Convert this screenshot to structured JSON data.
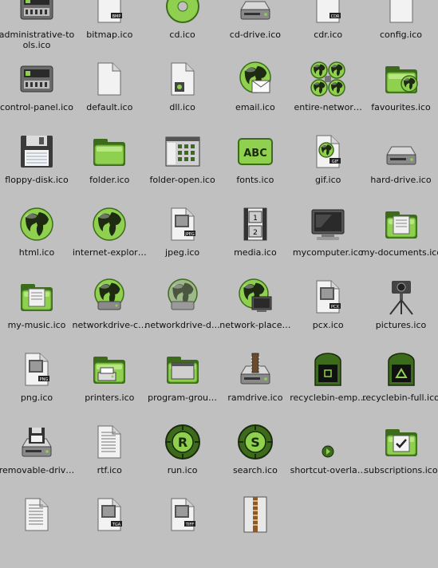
{
  "icons": [
    {
      "label": "administrative-tools.ico",
      "icon": "administrative-tools-icon",
      "kind": "panel"
    },
    {
      "label": "bitmap.ico",
      "icon": "bitmap-icon",
      "kind": "file",
      "badge": "BMP"
    },
    {
      "label": "cd.ico",
      "icon": "cd-icon",
      "kind": "disc"
    },
    {
      "label": "cd-drive.ico",
      "icon": "cd-drive-icon",
      "kind": "drive"
    },
    {
      "label": "cdr.ico",
      "icon": "cdr-icon",
      "kind": "file",
      "badge": "CDR"
    },
    {
      "label": "config.ico",
      "icon": "config-icon",
      "kind": "file"
    },
    {
      "label": "control-panel.ico",
      "icon": "control-panel-icon",
      "kind": "panel"
    },
    {
      "label": "default.ico",
      "icon": "default-file-icon",
      "kind": "file"
    },
    {
      "label": "dll.ico",
      "icon": "dll-icon",
      "kind": "file-gear"
    },
    {
      "label": "email.ico",
      "icon": "email-icon",
      "kind": "globe-mail"
    },
    {
      "label": "entire-networ…",
      "icon": "entire-network-icon",
      "kind": "globes"
    },
    {
      "label": "favourites.ico",
      "icon": "favourites-icon",
      "kind": "folder-globe"
    },
    {
      "label": "floppy-disk.ico",
      "icon": "floppy-disk-icon",
      "kind": "floppy"
    },
    {
      "label": "folder.ico",
      "icon": "folder-icon",
      "kind": "folder"
    },
    {
      "label": "folder-open.ico",
      "icon": "folder-open-icon",
      "kind": "window"
    },
    {
      "label": "fonts.ico",
      "icon": "fonts-icon",
      "kind": "fonts",
      "text": "ABC"
    },
    {
      "label": "gif.ico",
      "icon": "gif-icon",
      "kind": "file-globe",
      "badge": "GIF"
    },
    {
      "label": "hard-drive.ico",
      "icon": "hard-drive-icon",
      "kind": "drive"
    },
    {
      "label": "html.ico",
      "icon": "html-icon",
      "kind": "globe"
    },
    {
      "label": "internet-explor…",
      "icon": "internet-explorer-icon",
      "kind": "globe"
    },
    {
      "label": "jpeg.ico",
      "icon": "jpeg-icon",
      "kind": "file-pic",
      "badge": "JPEG"
    },
    {
      "label": "media.ico",
      "icon": "media-icon",
      "kind": "film"
    },
    {
      "label": "mycomputer.ico",
      "icon": "mycomputer-icon",
      "kind": "monitor"
    },
    {
      "label": "my-documents.ico",
      "icon": "my-documents-icon",
      "kind": "folder-doc"
    },
    {
      "label": "my-music.ico",
      "icon": "my-music-icon",
      "kind": "folder-doc"
    },
    {
      "label": "networkdrive-c…",
      "icon": "networkdrive-connected-icon",
      "kind": "globe-drive"
    },
    {
      "label": "networkdrive-d…",
      "icon": "networkdrive-disconnected-icon",
      "kind": "globe-drive-dim"
    },
    {
      "label": "network-place…",
      "icon": "network-places-icon",
      "kind": "globe-monitor"
    },
    {
      "label": "pcx.ico",
      "icon": "pcx-icon",
      "kind": "file-pic",
      "badge": "PCX"
    },
    {
      "label": "pictures.ico",
      "icon": "pictures-icon",
      "kind": "camera"
    },
    {
      "label": "png.ico",
      "icon": "png-icon",
      "kind": "file-pic",
      "badge": "PNG"
    },
    {
      "label": "printers.ico",
      "icon": "printers-icon",
      "kind": "folder-printer"
    },
    {
      "label": "program-grou…",
      "icon": "program-group-icon",
      "kind": "folder-window"
    },
    {
      "label": "ramdrive.ico",
      "icon": "ramdrive-icon",
      "kind": "drive-chip"
    },
    {
      "label": "recyclebin-emp…",
      "icon": "recyclebin-empty-icon",
      "kind": "bin"
    },
    {
      "label": "recyclebin-full.ico",
      "icon": "recyclebin-full-icon",
      "kind": "bin-full"
    },
    {
      "label": "removable-driv…",
      "icon": "removable-drive-icon",
      "kind": "drive-floppy"
    },
    {
      "label": "rtf.ico",
      "icon": "rtf-icon",
      "kind": "file-text"
    },
    {
      "label": "run.ico",
      "icon": "run-icon",
      "kind": "badge",
      "text": "R"
    },
    {
      "label": "search.ico",
      "icon": "search-icon",
      "kind": "badge",
      "text": "S"
    },
    {
      "label": "shortcut-overla…",
      "icon": "shortcut-overlay-icon",
      "kind": "dot"
    },
    {
      "label": "subscriptions.ico",
      "icon": "subscriptions-icon",
      "kind": "folder-check"
    },
    {
      "label": "",
      "icon": "text-file-icon",
      "kind": "file-text"
    },
    {
      "label": "",
      "icon": "tga-icon",
      "kind": "file-pic",
      "badge": "TGA"
    },
    {
      "label": "",
      "icon": "tiff-icon",
      "kind": "file-pic",
      "badge": "TIFF"
    },
    {
      "label": "",
      "icon": "zip-icon",
      "kind": "zip"
    }
  ],
  "colors": {
    "background": "#c0c0c0",
    "green": "#8fd14f",
    "green_dark": "#3d6b1c",
    "globe_land": "#1e2a12",
    "paper": "#f2f2f2",
    "metal": "#8a8a8a",
    "label_text": "#101010"
  }
}
